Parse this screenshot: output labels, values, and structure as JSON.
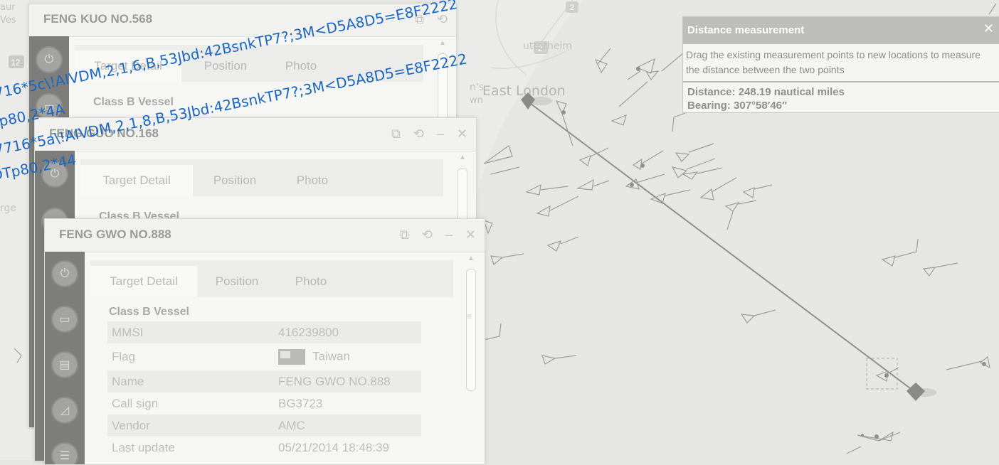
{
  "map": {
    "labels": {
      "east_london": "East London",
      "utterheim": "utterheim",
      "ns": "n's",
      "wn": "wn",
      "aur": "aur",
      "ves": "Ves",
      "rge": "rge",
      "route_2a": "2",
      "route_2b": "2",
      "route_12": "12"
    }
  },
  "windows": [
    {
      "title": "FENG KUO NO.568",
      "tabs": [
        "Target Detail",
        "Position",
        "Photo"
      ],
      "active_tab": "Target Detail",
      "class_label": "Class B Vessel"
    },
    {
      "title": "FENG GUO NO.168",
      "tabs": [
        "Target Detail",
        "Position",
        "Photo"
      ],
      "active_tab": "Target Detail",
      "class_label": "Class B Vessel"
    },
    {
      "title": "FENG GWO NO.888",
      "tabs": [
        "Target Detail",
        "Position",
        "Photo"
      ],
      "active_tab": "Target Detail",
      "class_label": "Class B Vessel",
      "rows": [
        {
          "label": "MMSI",
          "value": "416239800"
        },
        {
          "label": "Flag",
          "value": "Taiwan"
        },
        {
          "label": "Name",
          "value": "FENG GWO NO.888"
        },
        {
          "label": "Call sign",
          "value": "BG3723"
        },
        {
          "label": "Vendor",
          "value": "AMC"
        },
        {
          "label": "Last update",
          "value": "05/21/2014 18:48:39"
        }
      ]
    }
  ],
  "window_controls": {
    "restore": "⧉",
    "refresh": "⟲",
    "minimize": "–",
    "close": "✕"
  },
  "distance_panel": {
    "title": "Distance measurement",
    "close": "✕",
    "description": "Drag the existing measurement points to new locations to measure the distance between the two points",
    "distance": "Distance: 248.19 nautical miles",
    "bearing": "Bearing: 307°58′46″"
  },
  "nmea_overlay": {
    "line1": "716*5c\\!AIVDM,2,1,6,B,53Jbd:42BsnkTP7?;3M<D5A8D5=E8F2222",
    "line2": "Tp80,2*4A",
    "line3": "7716*5a\\!AIVDM,2,1,8,B,53Jbd:42BsnkTP7?;3M<D5A8D5=E8F2222",
    "line4": "DTp80,2*44"
  },
  "colors": {
    "map_bg": "#e6e6e4",
    "sidebar": "#7d7d7b",
    "nmea_text": "#1a66c2",
    "route": "#8c8c8a"
  }
}
